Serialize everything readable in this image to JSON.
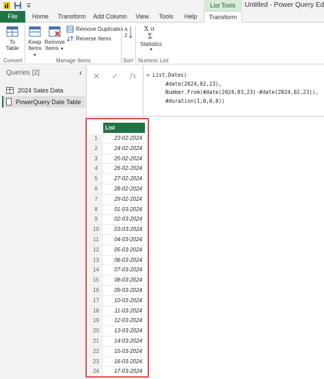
{
  "window": {
    "title": "Untitled - Power Query Editor",
    "context_tab_group": "List Tools"
  },
  "tabs": [
    "File",
    "Home",
    "Transform",
    "Add Column",
    "View",
    "Tools",
    "Help",
    "Transform"
  ],
  "ribbon": {
    "to_table_line1": "To",
    "to_table_line2": "Table",
    "keep_items_line1": "Keep",
    "keep_items_line2": "Items",
    "remove_items_line1": "Remove",
    "remove_items_line2": "Items",
    "remove_duplicates": "Remove Duplicates",
    "reverse_items": "Reverse Items",
    "sort_az": "A Z",
    "statistics": "Statistics",
    "groups": {
      "convert": "Convert",
      "manage_items": "Manage Items",
      "sort": "Sort",
      "numeric_list": "Numeric List"
    }
  },
  "queries": {
    "header": "Queries [2]",
    "items": [
      "2024 Sales Data",
      "PowerQuery Date Table"
    ]
  },
  "formula": {
    "fx": "fx",
    "line1": "= List.Dates(",
    "line2": "#date(2024,02,23),",
    "line3": "Number.From(#date(2024,03,23)-#date(2024,02,23)),",
    "line4": "#duration(1,0,0,0))"
  },
  "grid": {
    "column_header": "List",
    "row_numbers": [
      "1",
      "2",
      "3",
      "4",
      "5",
      "6",
      "7",
      "8",
      "9",
      "10",
      "11",
      "12",
      "13",
      "14",
      "15",
      "16",
      "17",
      "18",
      "19",
      "20",
      "21",
      "22",
      "23",
      "24"
    ],
    "values": [
      "23-02-2024",
      "24-02-2024",
      "25-02-2024",
      "26-02-2024",
      "27-02-2024",
      "28-02-2024",
      "29-02-2024",
      "01-03-2024",
      "02-03-2024",
      "03-03-2024",
      "04-03-2024",
      "05-03-2024",
      "06-03-2024",
      "07-03-2024",
      "08-03-2024",
      "09-03-2024",
      "10-03-2024",
      "11-03-2024",
      "12-03-2024",
      "13-03-2024",
      "14-03-2024",
      "15-03-2024",
      "16-03-2024",
      "17-03-2024"
    ]
  },
  "colors": {
    "accent": "#217346",
    "highlight_border": "#e04848"
  }
}
